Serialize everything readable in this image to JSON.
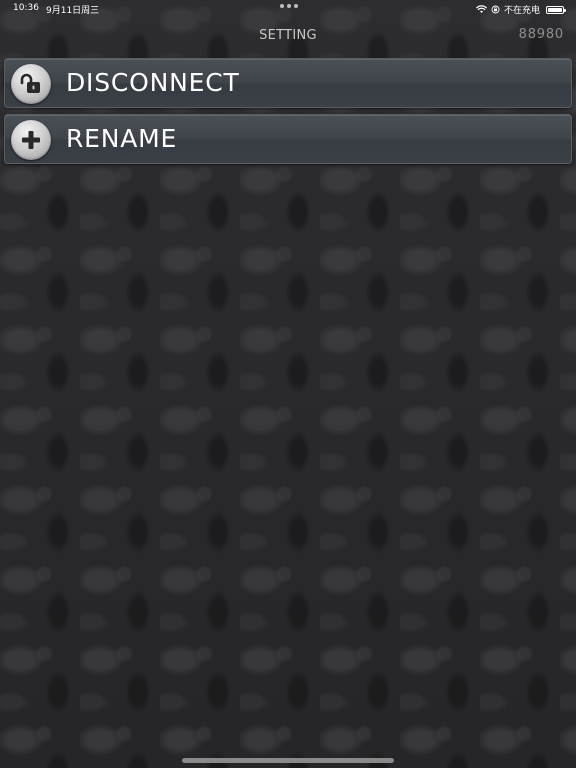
{
  "status_bar": {
    "time": "10:36",
    "date": "9月11日周三",
    "charging": "不在充电",
    "battery_level": 1.0
  },
  "nav": {
    "title": "SETTING",
    "right_value": "88980"
  },
  "menu": {
    "items": [
      {
        "label": "DISCONNECT",
        "icon": "unlocked-padlock-icon"
      },
      {
        "label": "RENAME",
        "icon": "plus-icon"
      }
    ]
  },
  "colors": {
    "background": "#2a2a2c",
    "row_background": "#40444b",
    "title_text": "#c8c8c8",
    "secondary_text": "#8e8e8e"
  }
}
